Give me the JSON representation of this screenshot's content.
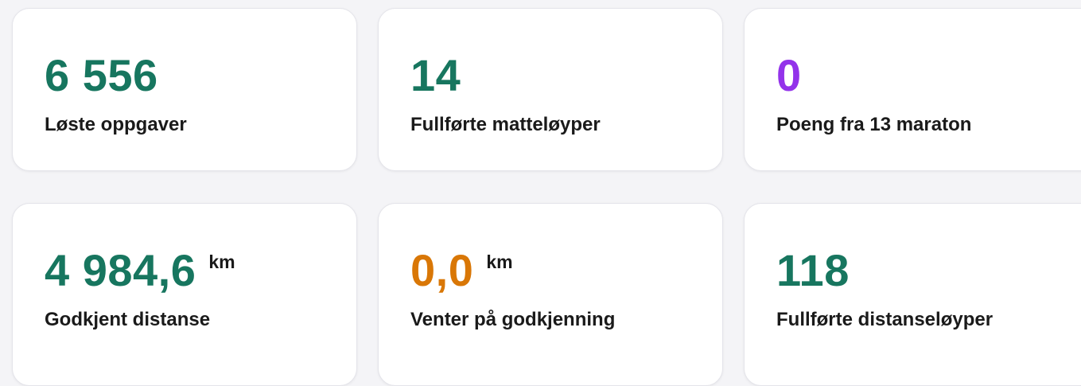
{
  "colors": {
    "green": "#17765f",
    "purple": "#9333ea",
    "orange": "#d97706"
  },
  "stats": [
    {
      "value": "6 556",
      "label": "Løste oppgaver",
      "color": "green"
    },
    {
      "value": "14",
      "label": "Fullførte matteløyper",
      "color": "green"
    },
    {
      "value": "0",
      "label": "Poeng fra 13 maraton",
      "color": "purple"
    },
    {
      "value": "4 984,6",
      "unit": "km",
      "label": "Godkjent distanse",
      "color": "green"
    },
    {
      "value": "0,0",
      "unit": "km",
      "label": "Venter på godkjenning",
      "color": "orange"
    },
    {
      "value": "118",
      "label": "Fullførte distanseløyper",
      "color": "green"
    }
  ]
}
